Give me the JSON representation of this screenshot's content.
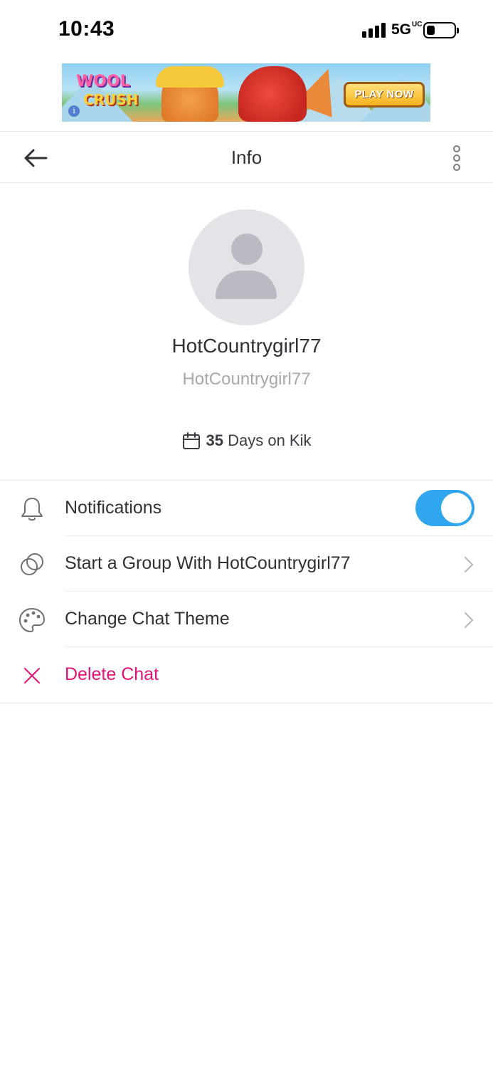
{
  "status_bar": {
    "time": "10:43",
    "network": "5G",
    "network_superscript": "UC",
    "signal_bars": 4,
    "battery_level": 0.3
  },
  "ad": {
    "logo_line1": "WOOL",
    "logo_line2": "CRUSH",
    "cta": "PLAY NOW",
    "info_glyph": "i"
  },
  "header": {
    "title": "Info",
    "back_icon": "arrow-left-icon",
    "more_icon": "more-vertical-icon"
  },
  "profile": {
    "display_name": "HotCountrygirl77",
    "username": "HotCountrygirl77",
    "days_count": "35",
    "days_suffix": "Days on Kik"
  },
  "settings": {
    "notifications_label": "Notifications",
    "notifications_on": true,
    "start_group_label": "Start a Group With HotCountrygirl77",
    "change_theme_label": "Change Chat Theme",
    "delete_label": "Delete Chat"
  },
  "colors": {
    "accent": "#2fa6ee",
    "destructive": "#e0127a",
    "secondary_text": "#a6a8ae"
  }
}
